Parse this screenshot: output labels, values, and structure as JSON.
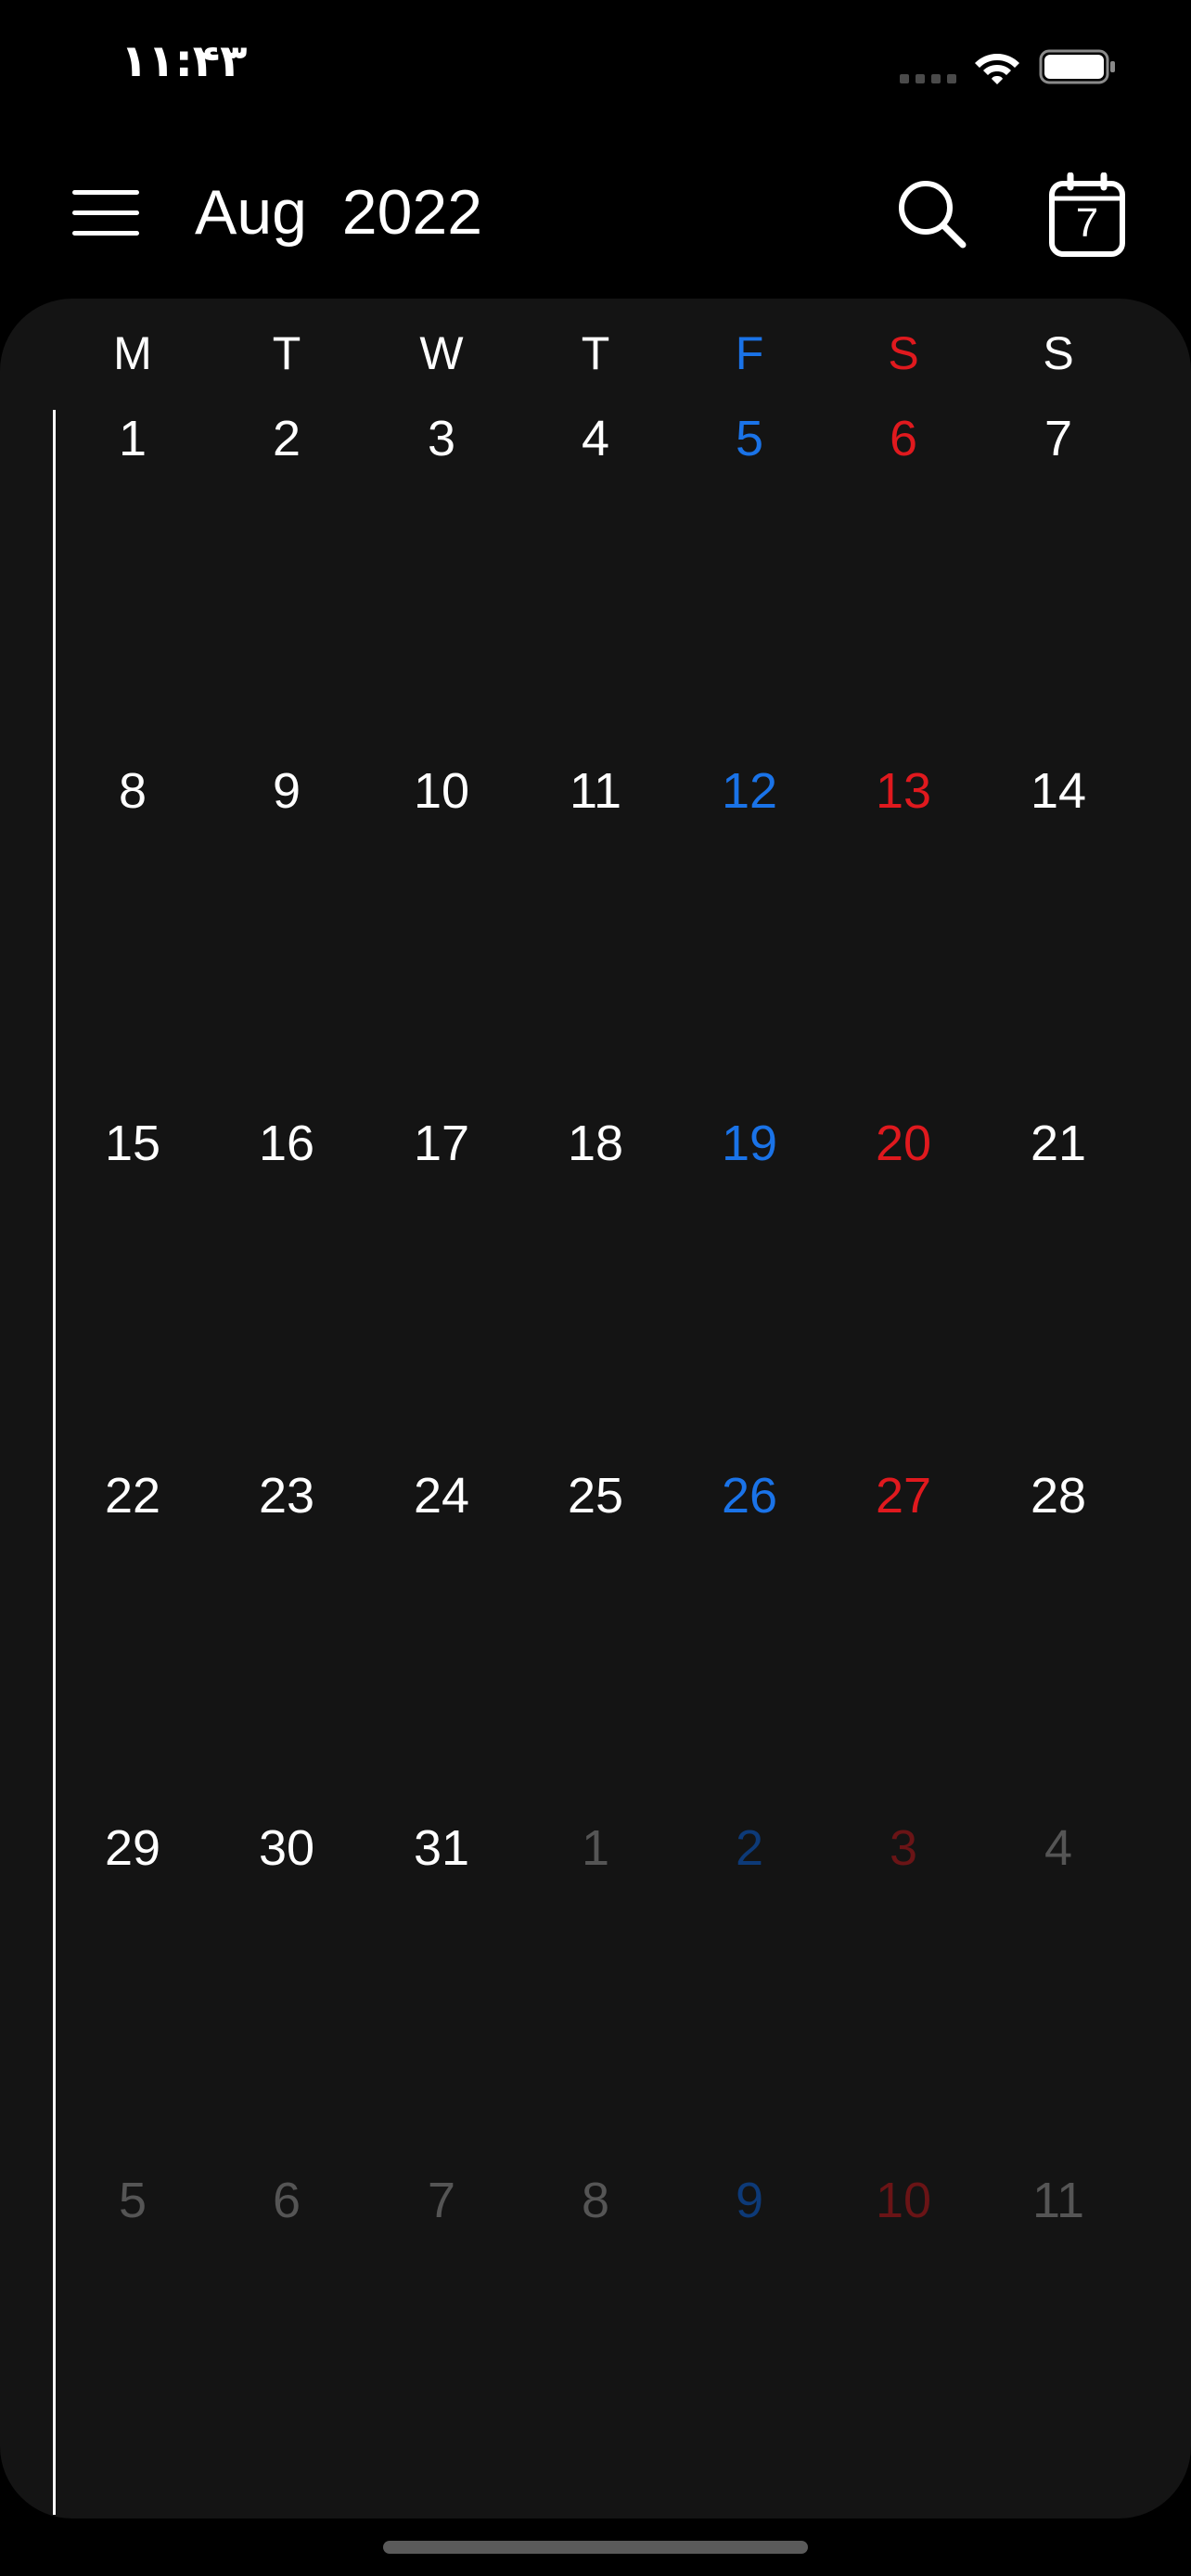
{
  "status_bar": {
    "time": "۱۱:۴۳"
  },
  "header": {
    "title": "Aug  2022",
    "today_day": "7"
  },
  "colors": {
    "background": "#000000",
    "panel": "#141414",
    "text": "#ffffff",
    "friday": "#1a73e8",
    "saturday": "#e0191e",
    "muted_text": "#555555",
    "muted_friday": "#0d3a78",
    "muted_saturday": "#6a1416"
  },
  "icons": {
    "menu": "hamburger-menu-icon",
    "search": "magnifier-search-icon",
    "today": "calendar-today-icon",
    "wifi": "wifi-icon",
    "battery": "battery-icon"
  },
  "weekdays": [
    "M",
    "T",
    "W",
    "T",
    "F",
    "S",
    "S"
  ],
  "weeks": [
    [
      "1",
      "2",
      "3",
      "4",
      "5",
      "6",
      "7"
    ],
    [
      "8",
      "9",
      "10",
      "11",
      "12",
      "13",
      "14"
    ],
    [
      "15",
      "16",
      "17",
      "18",
      "19",
      "20",
      "21"
    ],
    [
      "22",
      "23",
      "24",
      "25",
      "26",
      "27",
      "28"
    ],
    [
      "29",
      "30",
      "31",
      "1",
      "2",
      "3",
      "4"
    ],
    [
      "5",
      "6",
      "7",
      "8",
      "9",
      "10",
      "11"
    ]
  ],
  "month_days_in_last_rows": {
    "week_5_current_month_count": 3,
    "week_6_current_month_count": 0
  }
}
